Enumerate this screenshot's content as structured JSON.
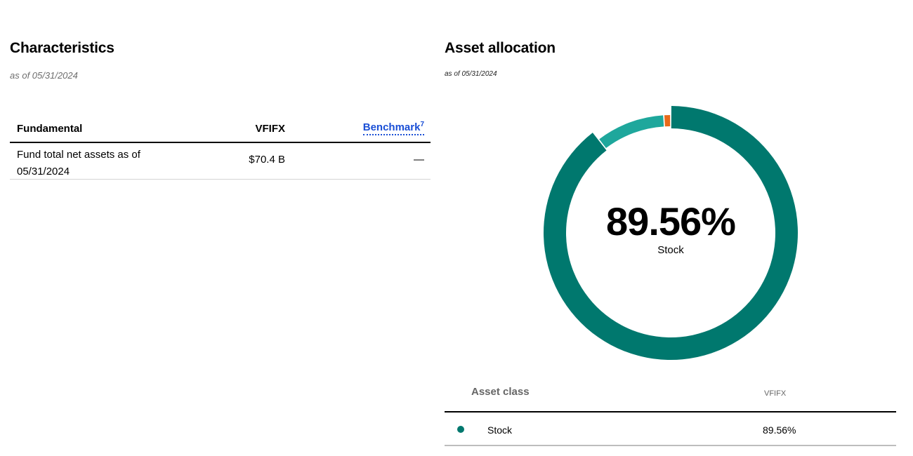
{
  "characteristics": {
    "title": "Characteristics",
    "as_of": "as of 05/31/2024",
    "table": {
      "headers": {
        "fundamental": "Fundamental",
        "fund": "VFIFX",
        "benchmark": "Benchmark",
        "benchmark_footnote": "7"
      },
      "rows": [
        {
          "name": "Fund total net assets as of 05/31/2024",
          "fund_value": "$70.4 B",
          "benchmark_value": "—"
        }
      ]
    }
  },
  "allocation": {
    "title": "Asset allocation",
    "as_of": "as of 05/31/2024",
    "center": {
      "value": "89.56%",
      "label": "Stock"
    },
    "table": {
      "headers": {
        "asset_class": "Asset class",
        "fund": "VFIFX"
      },
      "rows": [
        {
          "name": "Stock",
          "value": "89.56%",
          "color": "#00786e"
        }
      ]
    }
  },
  "chart_data": {
    "type": "pie",
    "style": "donut",
    "title": "",
    "categories": [
      "Stock",
      "",
      ""
    ],
    "values": [
      89.56,
      9.5,
      0.94
    ],
    "colors": [
      "#00786e",
      "#1ea79c",
      "#e86a1a"
    ],
    "start": "top, clockwise"
  }
}
